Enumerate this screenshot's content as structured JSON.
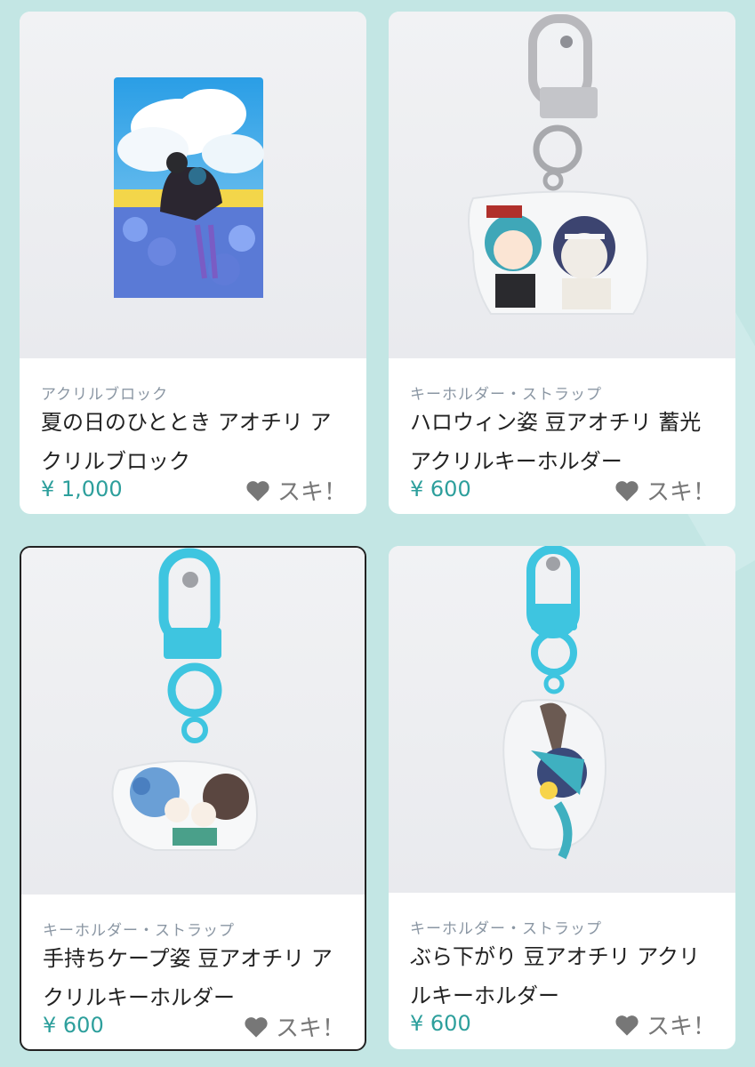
{
  "products": [
    {
      "category": "アクリルブロック",
      "title": "夏の日のひととき アオチリ アクリルブロック",
      "price": "¥ 1,000",
      "like_label": "スキ！",
      "image": "acrylic-block-photo"
    },
    {
      "category": "キーホルダー・ストラップ",
      "title": "ハロウィン姿 豆アオチリ 蓄光アクリルキーホルダー",
      "price": "¥ 600",
      "like_label": "スキ！",
      "image": "halloween-keychain-photo"
    },
    {
      "category": "キーホルダー・ストラップ",
      "title": "手持ちケープ姿 豆アオチリ アクリルキーホルダー",
      "price": "¥ 600",
      "like_label": "スキ！",
      "image": "cape-keychain-photo"
    },
    {
      "category": "キーホルダー・ストラップ",
      "title": "ぶら下がり 豆アオチリ アクリルキーホルダー",
      "price": "¥ 600",
      "like_label": "スキ！",
      "image": "hanging-keychain-photo"
    }
  ],
  "colors": {
    "background": "#c3e6e4",
    "price": "#2d9f9c",
    "category": "#8a96a3",
    "accent_clasp": "#3ec5e0"
  }
}
